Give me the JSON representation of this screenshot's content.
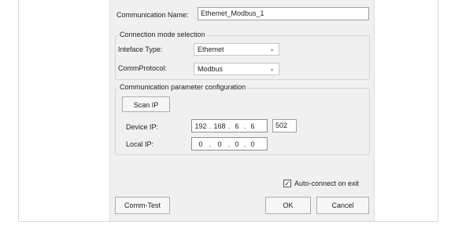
{
  "communication_name": {
    "label": "Communication Name:",
    "value": "Ethemet_Modbus_1"
  },
  "connection_mode": {
    "title": "Connection mode selection",
    "interface_type": {
      "label": "Inteface Type:",
      "value": "Ethemet"
    },
    "comm_protocol": {
      "label": "CommProtocol:",
      "value": "Modbus"
    }
  },
  "comm_params": {
    "title": "Communication parameter configuration",
    "scan_ip_label": "Scan IP",
    "device_ip": {
      "label": "Device IP:",
      "octets": [
        "192",
        "168",
        "6",
        "6"
      ],
      "port": "502"
    },
    "local_ip": {
      "label": "Local IP:",
      "octets": [
        "0",
        "0",
        "0",
        "0"
      ]
    }
  },
  "auto_connect": {
    "label": "Auto-connect on exit",
    "checked": true
  },
  "buttons": {
    "comm_test": "Comm-Test",
    "ok": "OK",
    "cancel": "Cancel"
  },
  "icons": {
    "dropdown": "chevron-down-icon",
    "check": "checkmark-icon"
  }
}
